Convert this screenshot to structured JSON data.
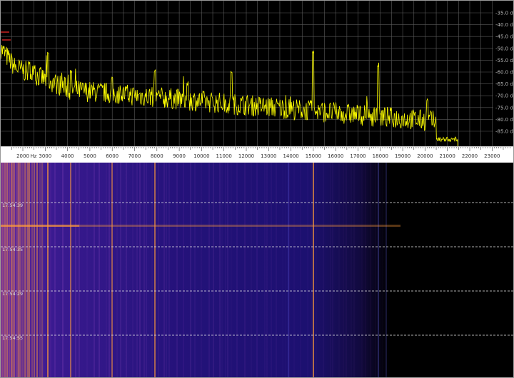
{
  "spectrum": {
    "db_labels": [
      "-35.0 dB",
      "-40.0 dB",
      "-45.0 dB",
      "-50.0 dB",
      "-55.0 dB",
      "-60.0 dB",
      "-65.0 dB",
      "-70.0 dB",
      "-75.0 dB",
      "-80.0 dB",
      "-85.0 dB"
    ],
    "trace_color": "#ffff00",
    "peak_marker_color": "#ff2a2a",
    "grid_color": "#5a5a5a"
  },
  "freq_axis": {
    "labels": [
      "2000",
      "3000",
      "4000",
      "5000",
      "6000",
      "7000",
      "8000",
      "9000",
      "10000",
      "11000",
      "12000",
      "13000",
      "14000",
      "15000",
      "16000",
      "17000",
      "18000",
      "19000",
      "20000",
      "21000",
      "22000",
      "23000"
    ],
    "unit": "Hz"
  },
  "waterfall": {
    "time_labels": [
      "17:54:39",
      "17:54:35",
      "17:54:29",
      "17:54:55"
    ],
    "background_color": "#20106a",
    "line_color": "#ff9a3a"
  }
}
